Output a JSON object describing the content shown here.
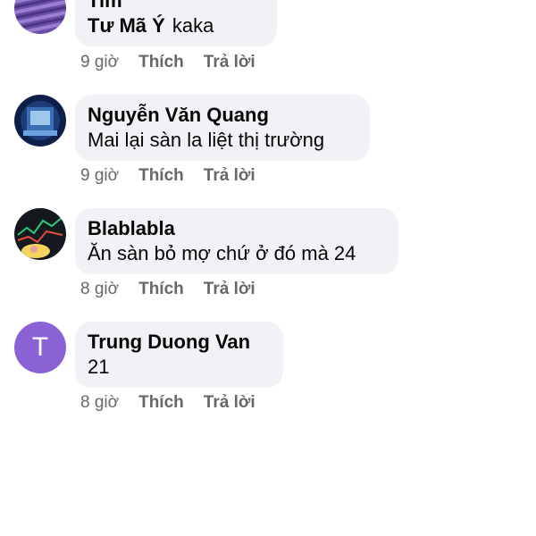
{
  "comments": [
    {
      "author": "Tim",
      "mention": "Tư Mã Ý",
      "text": "kaka",
      "time": "9 giờ",
      "like": "Thích",
      "reply": "Trả lời"
    },
    {
      "author": "Nguyễn Văn Quang",
      "text": "Mai lại sàn la liệt thị trường",
      "time": "9 giờ",
      "like": "Thích",
      "reply": "Trả lời"
    },
    {
      "author": "Blablabla",
      "text": "Ăn sàn bỏ mợ chứ ở đó mà 24",
      "time": "8 giờ",
      "like": "Thích",
      "reply": "Trả lời"
    },
    {
      "author": "Trung Duong Van",
      "avatar_letter": "T",
      "text": "21",
      "time": "8 giờ",
      "like": "Thích",
      "reply": "Trả lời"
    }
  ],
  "colors": {
    "bubble": "#f0f2f5",
    "action_text": "#65676b",
    "letter_avatar": "#8b62d6"
  }
}
